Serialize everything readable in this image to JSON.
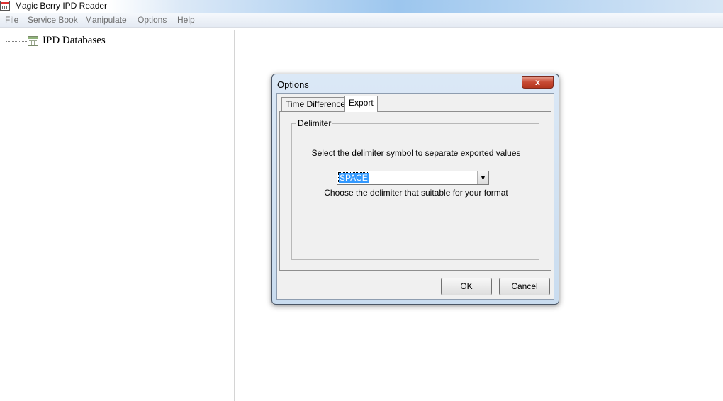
{
  "window": {
    "title": "Magic Berry IPD Reader"
  },
  "menu": {
    "items": [
      "File",
      "Service Book",
      "Manipulate",
      "Options",
      "Help"
    ]
  },
  "tree": {
    "root_label": "IPD Databases"
  },
  "dialog": {
    "title": "Options",
    "close_label": "x",
    "tabs": [
      {
        "label": "Time Difference",
        "active": false
      },
      {
        "label": "Export",
        "active": true
      }
    ],
    "group_label": "Delimiter",
    "instruction": "Select the delimiter symbol to separate exported values",
    "select_value": "SPACE",
    "hint": "Choose the delimiter that suitable for your format",
    "ok_label": "OK",
    "cancel_label": "Cancel"
  },
  "colors": {
    "selection": "#3399ff",
    "close_button": "#c74a34",
    "dialog_frame": "#c9dcef"
  },
  "icons": {
    "app": "app-table-icon",
    "tree_root": "database-grid-icon",
    "dropdown": "chevron-down-icon"
  }
}
